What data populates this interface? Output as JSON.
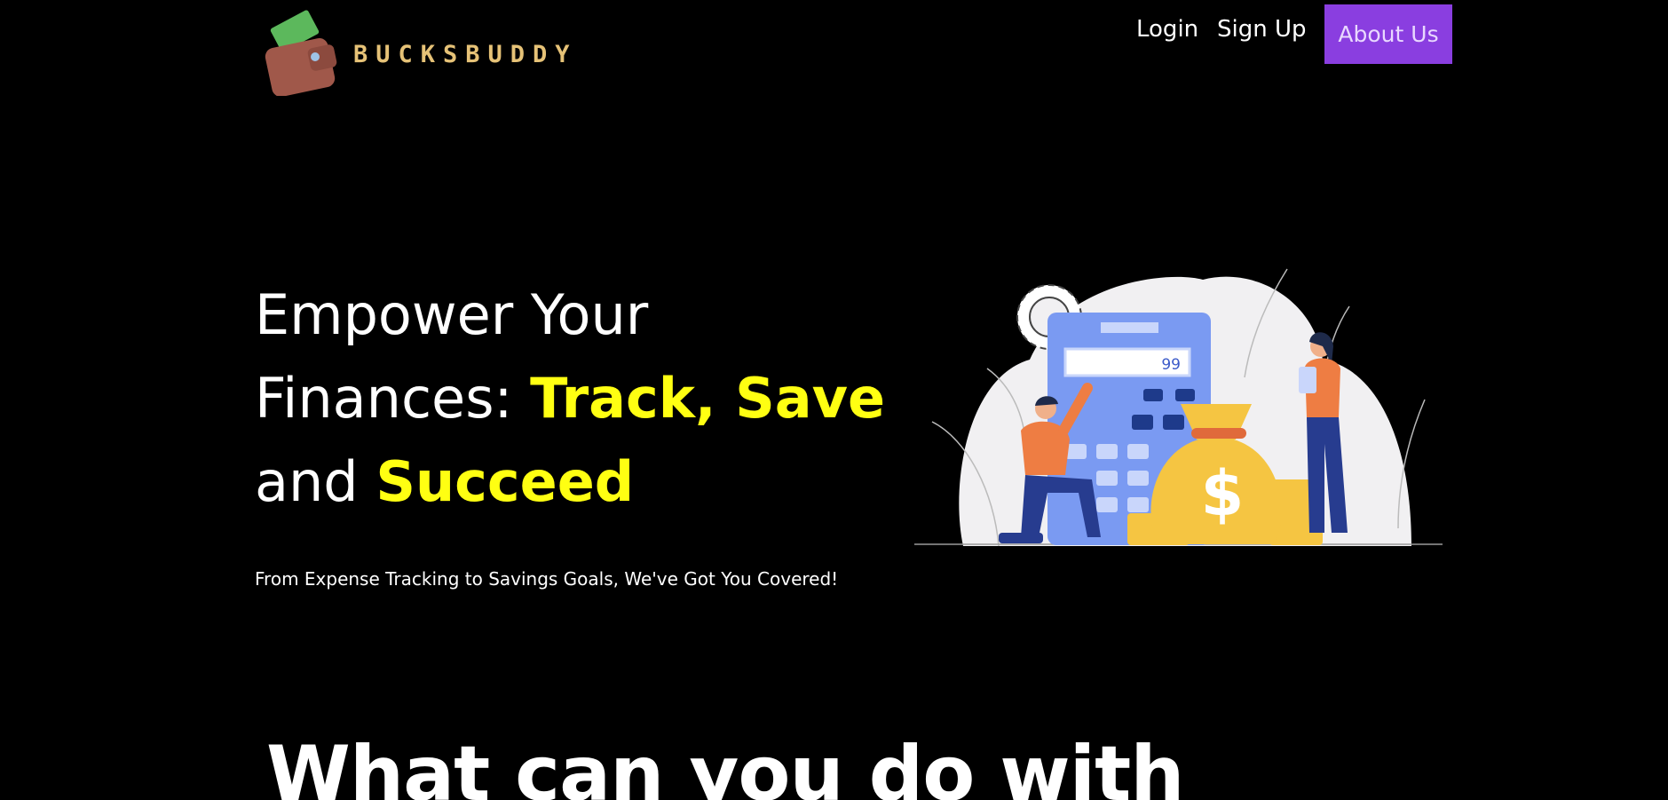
{
  "header": {
    "brand": "BUCKSBUDDY",
    "nav": {
      "login": "Login",
      "signup": "Sign Up",
      "about": "About Us"
    }
  },
  "hero": {
    "title_part1": "Empower Your",
    "title_part2": "Finances: ",
    "title_highlight1": "Track, Save",
    "title_part3": "and ",
    "title_highlight2": "Succeed",
    "subtitle": "From Expense Tracking to Savings Goals, We've Got You Covered!",
    "calculator_display": "99"
  },
  "section": {
    "heading": "What can you do with"
  },
  "colors": {
    "background": "#000000",
    "accent_purple": "#8a3ee0",
    "highlight_yellow": "#ffff12",
    "brand_gold": "#e6c277"
  }
}
